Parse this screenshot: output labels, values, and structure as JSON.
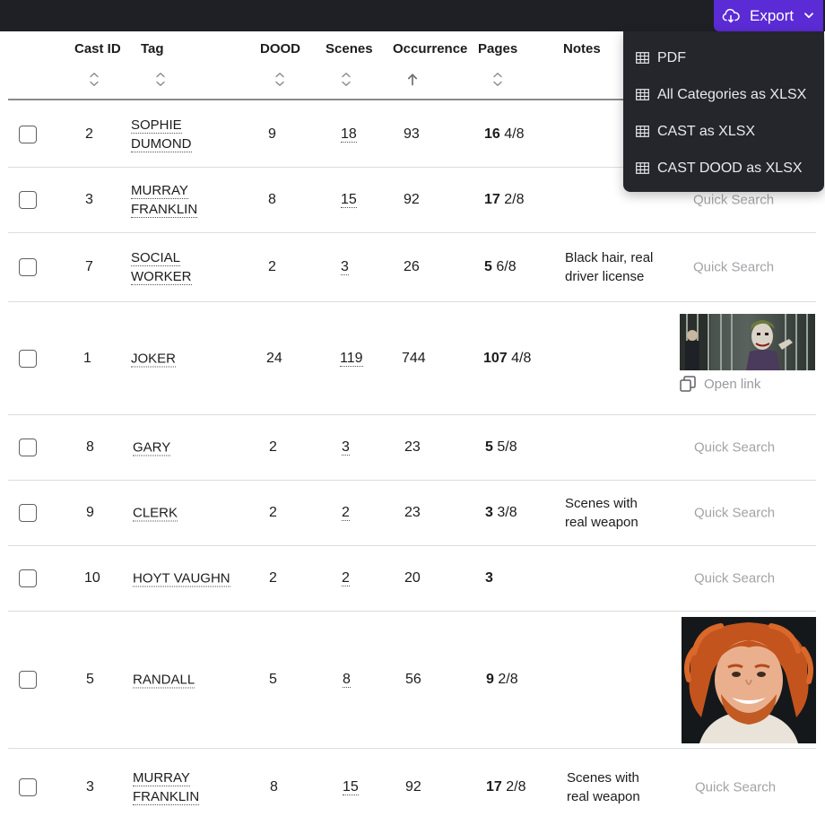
{
  "export": {
    "label": "Export",
    "icon": "cloud-download-icon"
  },
  "export_menu": [
    {
      "label": "PDF",
      "icon": "table-icon"
    },
    {
      "label": "All Categories as XLSX",
      "icon": "table-icon"
    },
    {
      "label": "CAST as XLSX",
      "icon": "table-icon"
    },
    {
      "label": "CAST DOOD as XLSX",
      "icon": "table-icon"
    }
  ],
  "columns": {
    "cast_id": "Cast ID",
    "tag": "Tag",
    "dood": "DOOD",
    "scenes": "Scenes",
    "occurrence": "Occurrence",
    "pages": "Pages",
    "notes": "Notes"
  },
  "rows": [
    {
      "cast_id": "2",
      "tag1": "SOPHIE",
      "tag2": "DUMOND",
      "dood": "9",
      "scenes": "18",
      "occurrence": "93",
      "pages_whole": "16",
      "pages_frac": "4/8",
      "notes1": "",
      "notes2": "",
      "action": ""
    },
    {
      "cast_id": "3",
      "tag1": "MURRAY",
      "tag2": "FRANKLIN",
      "dood": "8",
      "scenes": "15",
      "occurrence": "92",
      "pages_whole": "17",
      "pages_frac": "2/8",
      "notes1": "",
      "notes2": "",
      "action": "Quick Search"
    },
    {
      "cast_id": "7",
      "tag1": "SOCIAL",
      "tag2": "WORKER",
      "dood": "2",
      "scenes": "3",
      "occurrence": "26",
      "pages_whole": "5",
      "pages_frac": "6/8",
      "notes1": "Black hair, real",
      "notes2": "driver license",
      "action": "Quick Search"
    },
    {
      "cast_id": "1",
      "tag1": "JOKER",
      "tag2": "",
      "dood": "24",
      "scenes": "119",
      "occurrence": "744",
      "pages_whole": "107",
      "pages_frac": "4/8",
      "notes1": "",
      "notes2": "",
      "action": "Open link"
    },
    {
      "cast_id": "8",
      "tag1": "GARY",
      "tag2": "",
      "dood": "2",
      "scenes": "3",
      "occurrence": "23",
      "pages_whole": "5",
      "pages_frac": "5/8",
      "notes1": "",
      "notes2": "",
      "action": "Quick Search"
    },
    {
      "cast_id": "9",
      "tag1": "CLERK",
      "tag2": "",
      "dood": "2",
      "scenes": "2",
      "occurrence": "23",
      "pages_whole": "3",
      "pages_frac": "3/8",
      "notes1": "Scenes with",
      "notes2": "real weapon",
      "action": "Quick Search"
    },
    {
      "cast_id": "10",
      "tag1": "HOYT VAUGHN",
      "tag2": "",
      "dood": "2",
      "scenes": "2",
      "occurrence": "20",
      "pages_whole": "3",
      "pages_frac": "",
      "notes1": "",
      "notes2": "",
      "action": "Quick Search"
    },
    {
      "cast_id": "5",
      "tag1": "RANDALL",
      "tag2": "",
      "dood": "5",
      "scenes": "8",
      "occurrence": "56",
      "pages_whole": "9",
      "pages_frac": "2/8",
      "notes1": "",
      "notes2": "",
      "action": ""
    },
    {
      "cast_id": "3",
      "tag1": "MURRAY",
      "tag2": "FRANKLIN",
      "dood": "8",
      "scenes": "15",
      "occurrence": "92",
      "pages_whole": "17",
      "pages_frac": "2/8",
      "notes1": "Scenes with",
      "notes2": "real weapon",
      "action": "Quick Search"
    }
  ],
  "colors": {
    "accent": "#5b2bd6",
    "topbar": "#1f1f26",
    "menu": "#25252c",
    "muted": "#a3a3a8"
  }
}
